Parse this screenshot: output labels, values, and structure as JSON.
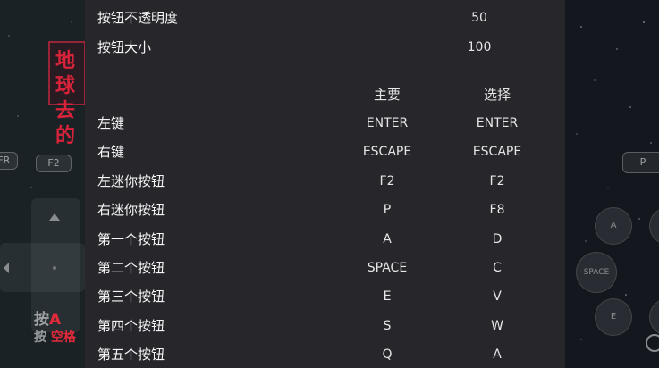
{
  "settings": {
    "opacity": {
      "label": "按钮不透明度",
      "value": "50"
    },
    "size": {
      "label": "按钮大小",
      "value": "100"
    },
    "headers": {
      "primary": "主要",
      "secondary": "选择"
    },
    "bindings": [
      {
        "label": "左键",
        "primary": "ENTER",
        "secondary": "ENTER"
      },
      {
        "label": "右键",
        "primary": "ESCAPE",
        "secondary": "ESCAPE"
      },
      {
        "label": "左迷你按钮",
        "primary": "F2",
        "secondary": "F2"
      },
      {
        "label": "右迷你按钮",
        "primary": "P",
        "secondary": "F8"
      },
      {
        "label": "第一个按钮",
        "primary": "A",
        "secondary": "D"
      },
      {
        "label": "第二个按钮",
        "primary": "SPACE",
        "secondary": "C"
      },
      {
        "label": "第三个按钮",
        "primary": "E",
        "secondary": "V"
      },
      {
        "label": "第四个按钮",
        "primary": "S",
        "secondary": "W"
      },
      {
        "label": "第五个按钮",
        "primary": "Q",
        "secondary": "A"
      }
    ]
  },
  "game": {
    "title_line1": "地球",
    "title_line2": "去的",
    "left_er": "ER",
    "left_f2": "F2",
    "bottom_text1": "按",
    "bottom_a": "A",
    "bottom_text2": "按",
    "bottom_space": "空格",
    "right_p": "P",
    "right_a": "A",
    "right_space": "SPACE",
    "right_e": "E"
  },
  "colors": {
    "panel_bg": "#26262b",
    "title_red": "#d8233a",
    "bottom_red": "#e02a3a"
  }
}
